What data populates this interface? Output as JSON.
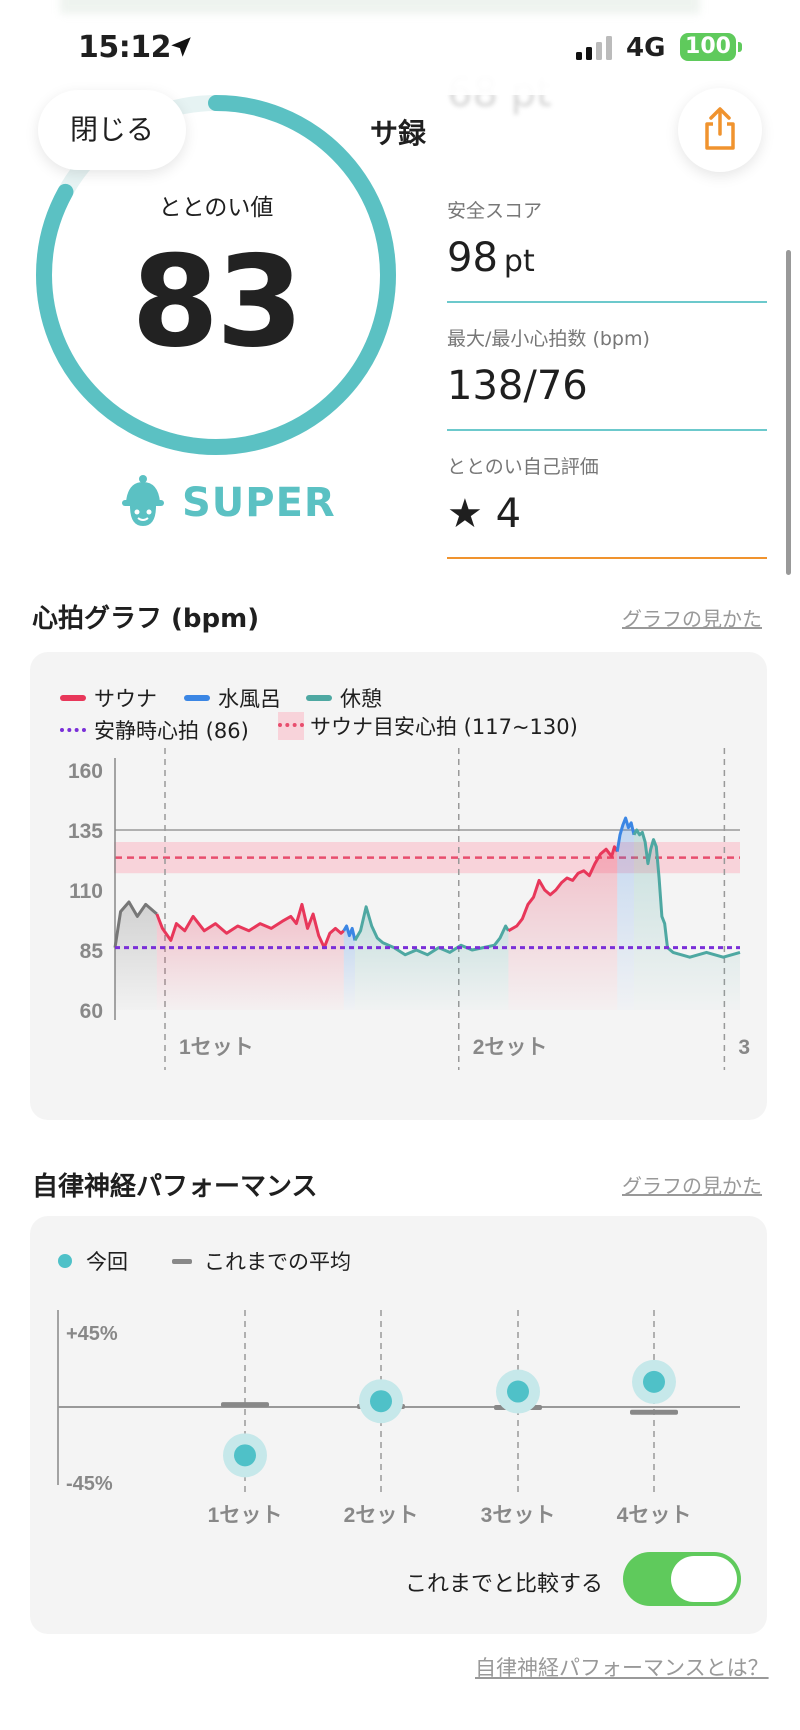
{
  "status_bar": {
    "time": "15:12",
    "network": "4G",
    "battery": "100"
  },
  "header": {
    "close_label": "閉じる",
    "title": "サ録"
  },
  "score": {
    "label": "ととのい値",
    "value": "83",
    "fraction": 0.83,
    "rank": "SUPER"
  },
  "stats": [
    {
      "label": "安全スコア",
      "value": "98",
      "unit": "pt"
    },
    {
      "label": "最大/最小心拍数 (bpm)",
      "value": "138/76",
      "unit": ""
    },
    {
      "label": "ととのい自己評価",
      "value": "★ 4",
      "unit": ""
    }
  ],
  "ghost_stat": {
    "value": "68 pt"
  },
  "heart_section": {
    "title": "心拍グラフ (bpm)",
    "link": "グラフの見かた"
  },
  "heart_legend": {
    "sauna": "サウナ",
    "water": "水風呂",
    "rest": "休憩",
    "resting_hr": "安静時心拍 (86)",
    "target_hr": "サウナ目安心拍 (117~130)"
  },
  "heart_colors": {
    "sauna": "#e8375a",
    "water": "#3b86e4",
    "rest": "#4ea8a2",
    "idle": "#777777",
    "resting": "#7a2fd8",
    "target": "#e84e6e"
  },
  "chart_data": [
    {
      "type": "line",
      "title": "心拍グラフ (bpm)",
      "ylim": [
        60,
        160
      ],
      "yticks": [
        "160",
        "135",
        "110",
        "85",
        "60"
      ],
      "set_labels": [
        "1セット",
        "2セット",
        "3"
      ],
      "resting_hr": 86,
      "target_range": [
        117,
        130
      ],
      "reference_line": 135,
      "set_boundaries": [
        0.08,
        0.55,
        0.975
      ],
      "segments": [
        {
          "phase": "idle",
          "points": [
            [
              0.0,
              86
            ],
            [
              0.01,
              101
            ],
            [
              0.025,
              105
            ],
            [
              0.04,
              99
            ],
            [
              0.055,
              104
            ],
            [
              0.075,
              100
            ]
          ]
        },
        {
          "phase": "sauna",
          "points": [
            [
              0.075,
              100
            ],
            [
              0.085,
              94
            ],
            [
              0.1,
              89
            ],
            [
              0.11,
              96
            ],
            [
              0.125,
              93
            ],
            [
              0.14,
              99
            ],
            [
              0.16,
              93
            ],
            [
              0.18,
              96
            ],
            [
              0.2,
              92
            ],
            [
              0.22,
              95
            ],
            [
              0.24,
              93
            ],
            [
              0.26,
              96
            ],
            [
              0.28,
              94
            ],
            [
              0.3,
              97
            ],
            [
              0.315,
              99
            ],
            [
              0.325,
              96
            ],
            [
              0.335,
              104
            ],
            [
              0.345,
              94
            ],
            [
              0.355,
              100
            ],
            [
              0.365,
              91
            ],
            [
              0.375,
              86
            ],
            [
              0.385,
              92
            ],
            [
              0.395,
              94
            ],
            [
              0.405,
              92
            ],
            [
              0.41,
              93
            ]
          ]
        },
        {
          "phase": "water",
          "points": [
            [
              0.41,
              93
            ],
            [
              0.415,
              95
            ],
            [
              0.42,
              91
            ],
            [
              0.425,
              94
            ],
            [
              0.43,
              89
            ]
          ]
        },
        {
          "phase": "rest",
          "points": [
            [
              0.43,
              89
            ],
            [
              0.44,
              93
            ],
            [
              0.45,
              103
            ],
            [
              0.46,
              95
            ],
            [
              0.47,
              90
            ],
            [
              0.48,
              88
            ],
            [
              0.5,
              86
            ],
            [
              0.52,
              83
            ],
            [
              0.54,
              85
            ],
            [
              0.56,
              83
            ],
            [
              0.58,
              86
            ],
            [
              0.6,
              84
            ],
            [
              0.62,
              87
            ],
            [
              0.64,
              85
            ],
            [
              0.66,
              86
            ],
            [
              0.68,
              87
            ],
            [
              0.69,
              90
            ],
            [
              0.7,
              95
            ],
            [
              0.705,
              93
            ]
          ]
        },
        {
          "phase": "sauna",
          "points": [
            [
              0.705,
              93
            ],
            [
              0.72,
              95
            ],
            [
              0.73,
              98
            ],
            [
              0.74,
              104
            ],
            [
              0.75,
              107
            ],
            [
              0.76,
              114
            ],
            [
              0.77,
              110
            ],
            [
              0.78,
              108
            ],
            [
              0.79,
              110
            ],
            [
              0.8,
              113
            ],
            [
              0.81,
              115
            ],
            [
              0.82,
              114
            ],
            [
              0.83,
              117
            ],
            [
              0.84,
              118
            ],
            [
              0.85,
              116
            ],
            [
              0.86,
              121
            ],
            [
              0.87,
              125
            ],
            [
              0.88,
              127
            ],
            [
              0.89,
              124
            ],
            [
              0.895,
              128
            ],
            [
              0.9,
              126
            ]
          ]
        },
        {
          "phase": "water",
          "points": [
            [
              0.9,
              126
            ],
            [
              0.905,
              133
            ],
            [
              0.91,
              137
            ],
            [
              0.915,
              140
            ],
            [
              0.92,
              136
            ],
            [
              0.925,
              138
            ],
            [
              0.93,
              133
            ]
          ]
        },
        {
          "phase": "rest",
          "points": [
            [
              0.93,
              133
            ],
            [
              0.935,
              135
            ],
            [
              0.94,
              133
            ],
            [
              0.945,
              134
            ],
            [
              0.95,
              130
            ],
            [
              0.955,
              121
            ],
            [
              0.96,
              127
            ],
            [
              0.965,
              131
            ],
            [
              0.97,
              128
            ],
            [
              0.975,
              115
            ],
            [
              0.98,
              99
            ],
            [
              0.985,
              96
            ],
            [
              0.99,
              86
            ],
            [
              1.0,
              84
            ],
            [
              1.03,
              82
            ],
            [
              1.06,
              84
            ],
            [
              1.09,
              82
            ],
            [
              1.12,
              84
            ]
          ]
        }
      ]
    },
    {
      "type": "scatter",
      "title": "自律神経パフォーマンス",
      "ylim": [
        -45,
        45
      ],
      "yticks": [
        "+45%",
        "-45%"
      ],
      "categories": [
        "1セット",
        "2セット",
        "3セット",
        "4セット"
      ],
      "series": [
        {
          "name": "今回",
          "values": [
            -25,
            3,
            8,
            13
          ]
        },
        {
          "name": "これまでの平均",
          "values": [
            1,
            0,
            -0.5,
            -3
          ]
        }
      ]
    }
  ],
  "anp_section": {
    "title": "自律神経パフォーマンス",
    "link": "グラフの見かた"
  },
  "anp_legend": {
    "current": "今回",
    "average": "これまでの平均"
  },
  "compare_toggle": {
    "label": "これまでと比較する",
    "on": true
  },
  "bottom_link": "自律神経パフォーマンスとは？"
}
